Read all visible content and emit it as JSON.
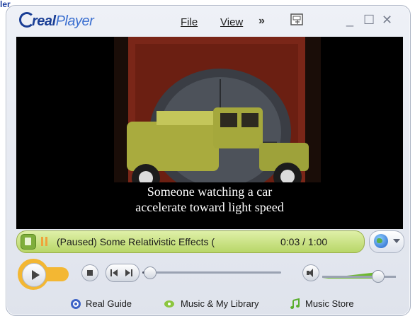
{
  "page_label": "ler",
  "app": {
    "logo_real": "real",
    "logo_player": "Player"
  },
  "menu": {
    "file": "File",
    "view": "View",
    "more": "»"
  },
  "window_controls": {
    "minimize": "_",
    "maximize": "☐",
    "close": "✕"
  },
  "video": {
    "subtitle_line1": "Someone watching a car",
    "subtitle_line2": "accelerate toward light speed"
  },
  "status": {
    "text": "(Paused) Some Relativistic Effects (",
    "time": "0:03 / 1:00",
    "state": "paused"
  },
  "playback": {
    "position_fraction": 0.05,
    "volume_fraction": 0.75
  },
  "bottom_links": [
    {
      "label": "Real Guide",
      "icon": "real-guide-icon"
    },
    {
      "label": "Music & My Library",
      "icon": "music-library-icon"
    },
    {
      "label": "Music Store",
      "icon": "music-store-icon"
    }
  ],
  "colors": {
    "accent_green": "#b8d668",
    "play_orange": "#f3b733",
    "brand_blue": "#1a3e95"
  }
}
